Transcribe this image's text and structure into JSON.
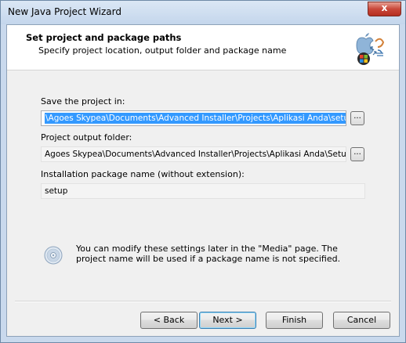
{
  "window": {
    "title": "New Java Project Wizard",
    "close_glyph": "x"
  },
  "header": {
    "title": "Set project and package paths",
    "subtitle": "Specify project location, output folder and package name",
    "logo_icon": "java-platform-logo-icon"
  },
  "fields": {
    "project_location": {
      "label": "Save the project in:",
      "value": "\\Agoes Skypea\\Documents\\Advanced Installer\\Projects\\Aplikasi Anda\\setup.aip",
      "browse_label": "..."
    },
    "output_folder": {
      "label": "Project output folder:",
      "value": "Agoes Skypea\\Documents\\Advanced Installer\\Projects\\Aplikasi Anda\\Setup Files",
      "browse_label": "..."
    },
    "package_name": {
      "label": "Installation package name (without extension):",
      "value": "setup"
    }
  },
  "info": {
    "icon": "cd-disc-icon",
    "text": "You can modify these settings later in the \"Media\" page. The project name will be used if a package name is not specified."
  },
  "buttons": {
    "back": "< Back",
    "next": "Next >",
    "finish": "Finish",
    "cancel": "Cancel"
  }
}
